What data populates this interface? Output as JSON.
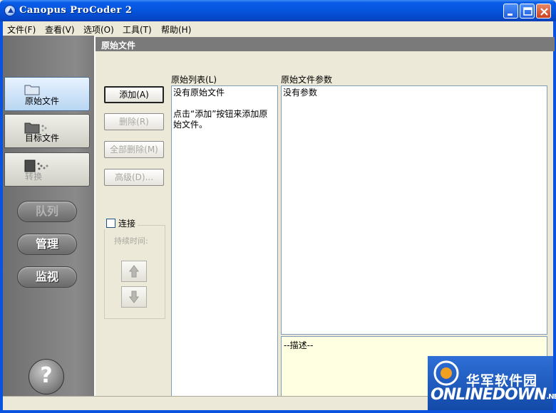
{
  "window": {
    "title": "Canopus ProCoder 2"
  },
  "menu": [
    {
      "label": "文件(F)"
    },
    {
      "label": "查看(V)"
    },
    {
      "label": "选项(O)"
    },
    {
      "label": "工具(T)"
    },
    {
      "label": "帮助(H)"
    }
  ],
  "sidebar": {
    "tabs": [
      {
        "label": "原始文件",
        "state": "active"
      },
      {
        "label": "目标文件",
        "state": "normal"
      },
      {
        "label": "转换",
        "state": "disabled"
      }
    ],
    "buttons": [
      {
        "label": "队列",
        "state": "disabled"
      },
      {
        "label": "管理",
        "state": "normal"
      },
      {
        "label": "监视",
        "state": "normal"
      }
    ],
    "help_label": "?"
  },
  "panel": {
    "header": "原始文件",
    "buttons": {
      "add": "添加(A)",
      "delete": "删除(R)",
      "delete_all": "全部删除(M)",
      "advanced": "高级(D)..."
    },
    "connect_label": "连接",
    "duration_label": "持续时间:",
    "source_list": {
      "label": "原始列表(L)",
      "empty_text": "没有原始文件",
      "hint": "点击“添加”按钮来添加原始文件。"
    },
    "params": {
      "label": "原始文件参数",
      "empty_text": "没有参数"
    },
    "description": "--描述--"
  },
  "watermark": {
    "cn": "华军软件园",
    "en": "ONLINEDOWN",
    "suffix": ".NET"
  },
  "colors": {
    "titlebar": "#0554dc",
    "sidebar": "#7a7a7a",
    "header_bar": "#7a7a7a",
    "description_bg": "#ffffe1",
    "active_tab": "#b8d6f2"
  }
}
